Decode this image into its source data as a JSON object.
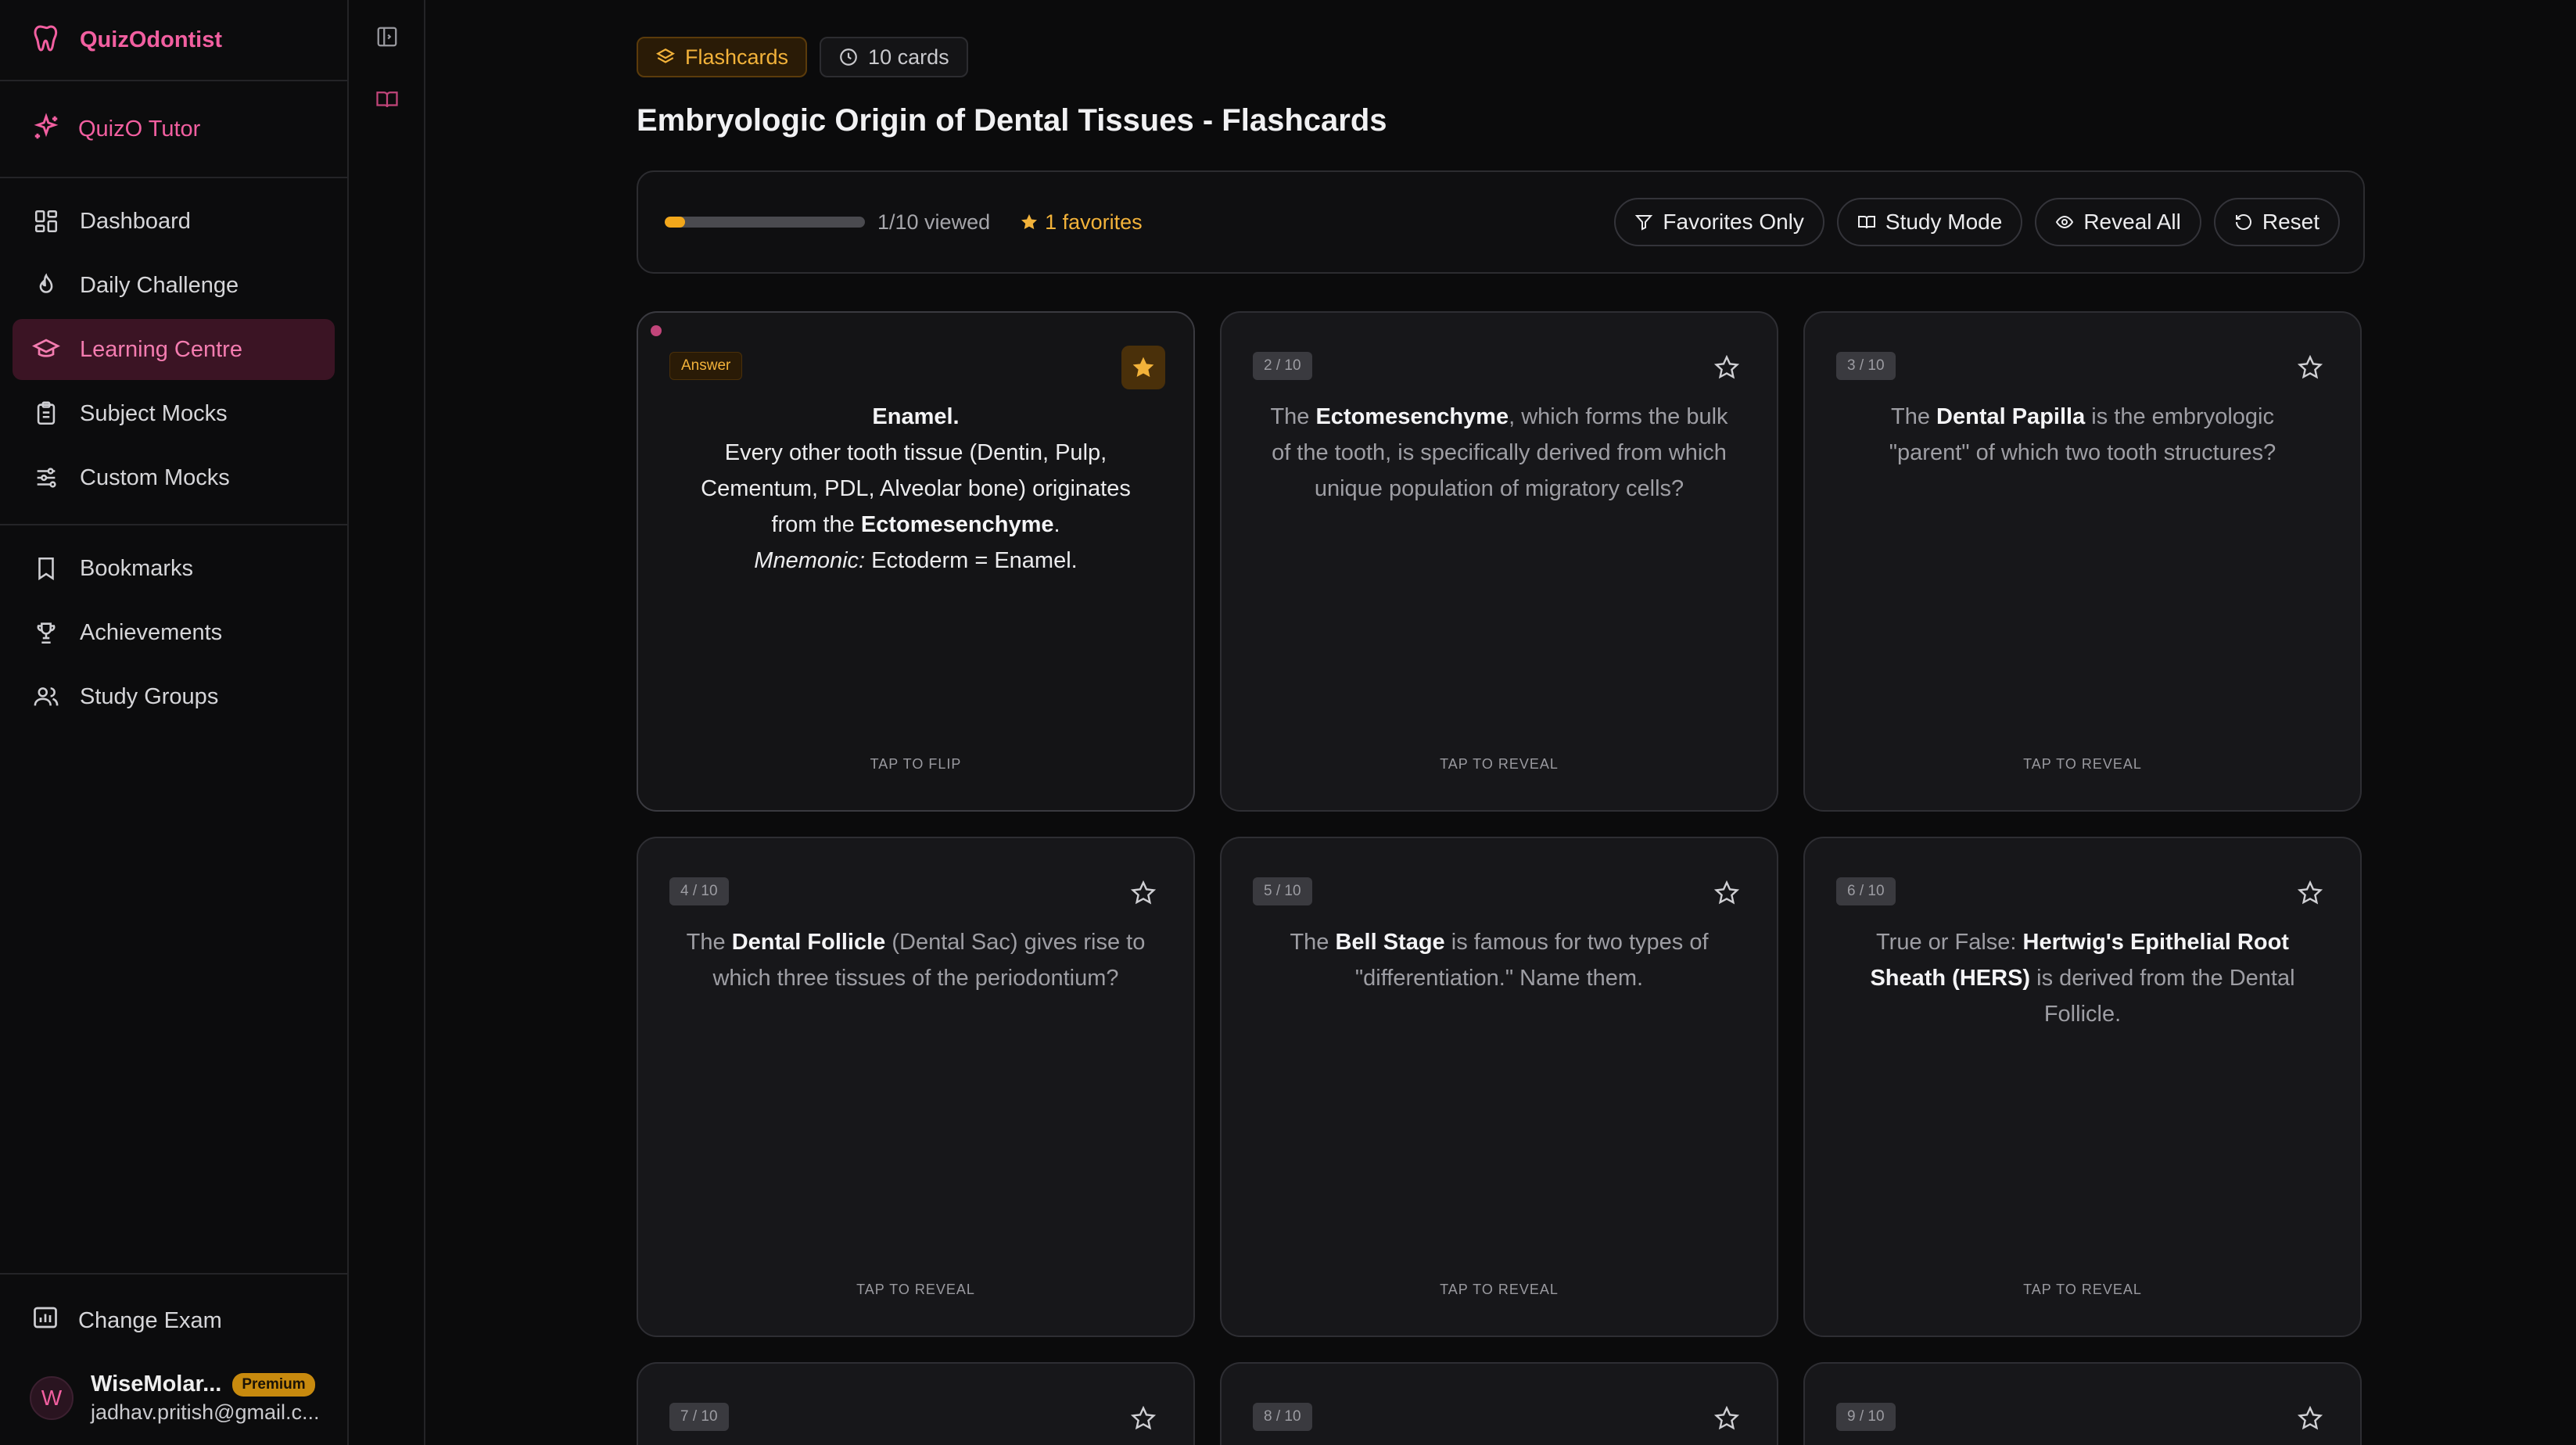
{
  "app": {
    "name": "QuizOdontist"
  },
  "tutor": {
    "label": "QuizO Tutor"
  },
  "nav": [
    {
      "label": "Dashboard",
      "icon": "dashboard-icon"
    },
    {
      "label": "Daily Challenge",
      "icon": "flame-icon"
    },
    {
      "label": "Learning Centre",
      "icon": "graduation-cap-icon",
      "active": true
    },
    {
      "label": "Subject Mocks",
      "icon": "clipboard-icon"
    },
    {
      "label": "Custom Mocks",
      "icon": "sliders-icon"
    }
  ],
  "nav2": [
    {
      "label": "Bookmarks",
      "icon": "bookmark-icon"
    },
    {
      "label": "Achievements",
      "icon": "trophy-icon"
    },
    {
      "label": "Study Groups",
      "icon": "users-icon"
    }
  ],
  "bottom": {
    "change_exam": "Change Exam",
    "user": {
      "initial": "W",
      "name": "WiseMolar...",
      "badge": "Premium",
      "email": "jadhav.pritish@gmail.c..."
    }
  },
  "header": {
    "chip_type": "Flashcards",
    "chip_count": "10 cards",
    "title": "Embryologic Origin of Dental Tissues - Flashcards"
  },
  "toolbar": {
    "progress_fraction": 0.1,
    "viewed": "1/10 viewed",
    "favorites": "1 favorites",
    "buttons": {
      "favorites_only": "Favorites Only",
      "study_mode": "Study Mode",
      "reveal_all": "Reveal All",
      "reset": "Reset"
    }
  },
  "cards": [
    {
      "badge": "Answer",
      "favorite": true,
      "hint": "TAP TO FLIP"
    },
    {
      "badge": "2 / 10",
      "favorite": false,
      "hint": "TAP TO REVEAL"
    },
    {
      "badge": "3 / 10",
      "favorite": false,
      "hint": "TAP TO REVEAL"
    },
    {
      "badge": "4 / 10",
      "favorite": false,
      "hint": "TAP TO REVEAL"
    },
    {
      "badge": "5 / 10",
      "favorite": false,
      "hint": "TAP TO REVEAL"
    },
    {
      "badge": "6 / 10",
      "favorite": false,
      "hint": "TAP TO REVEAL"
    },
    {
      "badge": "7 / 10",
      "favorite": false
    },
    {
      "badge": "8 / 10",
      "favorite": false
    },
    {
      "badge": "9 / 10",
      "favorite": false
    }
  ],
  "card_text": {
    "c1": {
      "a": "Enamel.",
      "b": "Every other tooth tissue (Dentin, Pulp, Cementum, PDL, Alveolar bone) originates from the ",
      "c": "Ectomesenchyme",
      "d": ".",
      "e": "Mnemonic:",
      "f": " Ectoderm = Enamel."
    },
    "c2": {
      "a": "The ",
      "b": "Ectomesenchyme",
      "c": ", which forms the bulk of the tooth, is specifically derived from which unique population of migratory cells?"
    },
    "c3": {
      "a": "The ",
      "b": "Dental Papilla",
      "c": " is the embryologic \"parent\" of which two tooth structures?"
    },
    "c4": {
      "a": "The ",
      "b": "Dental Follicle",
      "c": " (Dental Sac) gives rise to which three tissues of the periodontium?"
    },
    "c5": {
      "a": "The ",
      "b": "Bell Stage",
      "c": " is famous for two types of \"differentiation.\" Name them."
    },
    "c6": {
      "a": "True or False: ",
      "b": "Hertwig's Epithelial Root Sheath (HERS)",
      "c": " is derived from the Dental Follicle."
    }
  },
  "colors": {
    "accent": "#f25fa0",
    "gold": "#f2b23a",
    "background": "#0b0b0c"
  }
}
